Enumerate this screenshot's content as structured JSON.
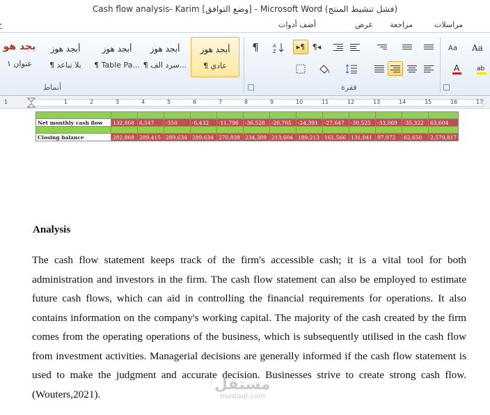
{
  "window": {
    "title": "Cash flow analysis- Karim [وضع التوافق] - Microsoft Word (فشل تنشيط المنتج)"
  },
  "tabs": [
    "ح",
    "مراسلات",
    "مراجعة",
    "عرض",
    "أضف أدوات"
  ],
  "styles_group": {
    "label": "أنماط",
    "styles": [
      {
        "sample": "أبجد هوز",
        "name": "¶ عادي",
        "active": true
      },
      {
        "sample": "أبجد هوز",
        "name": "¶ سرد الف...",
        "active": false
      },
      {
        "sample": "أبجد هوز",
        "name": "¶ Table Pa...",
        "active": false
      },
      {
        "sample": "أبجد هوز",
        "name": "¶ بلا تباعد",
        "active": false
      },
      {
        "sample": "بجد هو",
        "name": "عنوان ١",
        "active": false
      }
    ]
  },
  "paragraph_group": {
    "label": "فقرة",
    "icons": [
      "pilcrow-icon",
      "sort-icon",
      "ltr-direction-icon",
      "rtl-direction-icon",
      "decrease-indent-icon",
      "increase-indent-icon",
      "multilevel-list-icon",
      "numbering-icon",
      "bullets-icon",
      "borders-icon",
      "shading-icon",
      "line-spacing-icon",
      "justify-icon",
      "align-right-icon",
      "center-icon",
      "align-left-icon"
    ]
  },
  "font_group": {
    "label": "",
    "icons": [
      "change-case-icon",
      "font-color-icon",
      "highlight-icon",
      "clear-format-icon"
    ]
  },
  "ruler": {
    "numbers": [
      "17",
      "16",
      "15",
      "14",
      "13",
      "12",
      "11",
      "10",
      "9",
      "8",
      "7",
      "6",
      "5",
      "4",
      "3",
      "2",
      "1",
      "1"
    ]
  },
  "table": {
    "rows": [
      {
        "label": "Net monthly cash flow",
        "values": [
          "132,868",
          "6,547",
          "-350",
          "-6,432",
          "-11,796",
          "-36,528",
          "-20,705",
          "-24,391",
          "-27,647",
          "-30,525",
          "-33,069",
          "-35,322",
          "63,604"
        ]
      },
      {
        "label": "Closing balance",
        "values": [
          "282,868",
          "289,415",
          "289,634",
          "289,634",
          "270,838",
          "234,309",
          "213,604",
          "189,213",
          "161,566",
          "131,041",
          "97,972",
          "62,650",
          "2,579,817"
        ]
      }
    ]
  },
  "document": {
    "heading": "Analysis",
    "paragraph": "The cash flow statement keeps track of the firm's accessible cash; it is a vital tool for both administration and investors in the firm. The cash flow statement can also be employed to estimate future cash flows, which can aid in controlling the financial requirements for operations. It also contains information on the company's working capital. The majority of the cash created by the firm comes from the operating operations of the business, which is subsequently utilised in the cash flow from investment activities. Managerial decisions are generally informed if the cash flow statement is used to make the judgment  and accurate decision. Businesses strive to create strong cash flow. (Wouters,2021)."
  },
  "watermark": {
    "arabic": "مستقل",
    "url": "mostaql.com"
  },
  "colors": {
    "table_red": "#c0504d",
    "table_green": "#92d050",
    "active_style": "#ffe79e"
  }
}
